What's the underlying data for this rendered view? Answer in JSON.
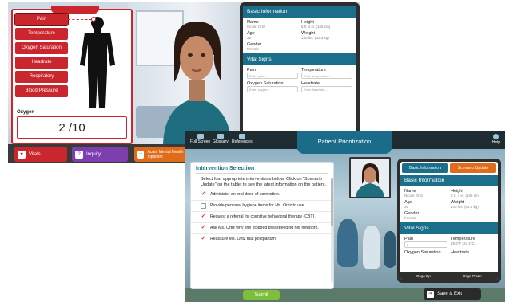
{
  "screenshot1": {
    "body_buttons": [
      {
        "label": "Pain",
        "active": true
      },
      {
        "label": "Temperature"
      },
      {
        "label": "Oxygen Saturation"
      },
      {
        "label": "Heartrate"
      },
      {
        "label": "Respiratory"
      },
      {
        "label": "Blood Pressure"
      }
    ],
    "oxygen_label": "Oxygen",
    "oxygen_value": "2 /10",
    "bottom_tabs": {
      "vitals": "Vitals",
      "inquiry": "Inquiry",
      "acute": "Acute Mental Health Inpatient"
    },
    "tablet": {
      "basic_info_title": "Basic Information",
      "name_label": "Name",
      "name_value": "Nicole Ortiz",
      "height_label": "Height",
      "height_value": "5 ft. 4 in. (165 cm)",
      "age_label": "Age",
      "age_value": "35",
      "weight_label": "Weight",
      "weight_value": "140 lbs. (63.5 kg)",
      "gender_label": "Gender",
      "gender_value": "Female",
      "vitals_title": "Vital Signs",
      "pain_label": "Pain",
      "pain_placeholder": "Enter pain...",
      "temp_label": "Temperature",
      "temp_placeholder": "Enter temperature...",
      "oxy_label": "Oxygen Saturation",
      "oxy_placeholder": "Enter oxygen...",
      "heart_label": "Heartrate",
      "heart_placeholder": "Enter heartrate..."
    }
  },
  "screenshot2": {
    "topbar": {
      "fullscreen": "Full Screen",
      "glossary": "Glossary",
      "references": "References",
      "help": "Help"
    },
    "title": "Patient Prioritization",
    "panel_title": "Intervention Selection",
    "instructions": "Select four appropriate interventions below. Click on \"Scenario Update\" on the tablet to see the latest information on the patient.",
    "interventions": [
      {
        "text": "Administer an oral dose of paroxetine.",
        "checked": true
      },
      {
        "text": "Provide personal hygiene items for Ms. Ortiz to use.",
        "checked": false
      },
      {
        "text": "Request a referral for cognitive behavioral therapy (CBT).",
        "checked": true
      },
      {
        "text": "Ask Ms. Ortiz why she stopped breastfeeding her newborn.",
        "checked": true
      },
      {
        "text": "Reassure Ms. Ortiz that postpartum",
        "checked": true
      }
    ],
    "submit_label": "Submit",
    "tablet": {
      "tab_basic": "Basic Information",
      "tab_update": "Scenario Update",
      "basic_info_title": "Basic Information",
      "name_label": "Name",
      "name_value": "Nicole Ortiz",
      "height_label": "Height",
      "height_value": "5 ft. 4 in. (165 cm)",
      "age_label": "Age",
      "age_value": "35",
      "weight_label": "Weight",
      "weight_value": "140 lbs. (63.5 kg)",
      "gender_label": "Gender",
      "gender_value": "Female",
      "vitals_title": "Vital Signs",
      "pain_label": "Pain",
      "pain_value": "2",
      "temp_label": "Temperature",
      "temp_value": "99.3°F (37.4°C)",
      "oxy_label": "Oxygen Saturation",
      "heart_label": "Heartrate",
      "page_up": "Page Up",
      "page_down": "Page Down"
    },
    "save_exit": "Save & Exit"
  }
}
